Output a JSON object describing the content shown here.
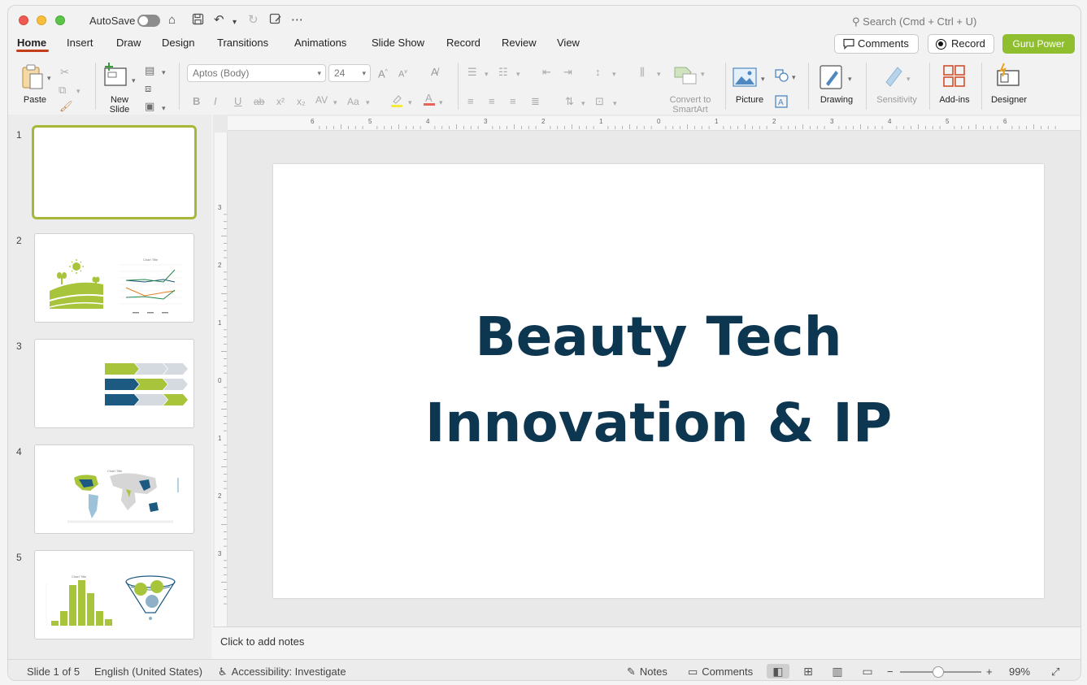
{
  "titlebar": {
    "autosave_label": "AutoSave",
    "search_placeholder": "Search (Cmd + Ctrl + U)"
  },
  "tabs": [
    {
      "label": "Home"
    },
    {
      "label": "Insert"
    },
    {
      "label": "Draw"
    },
    {
      "label": "Design"
    },
    {
      "label": "Transitions"
    },
    {
      "label": "Animations"
    },
    {
      "label": "Slide Show"
    },
    {
      "label": "Record"
    },
    {
      "label": "Review"
    },
    {
      "label": "View"
    }
  ],
  "header_buttons": {
    "comments": "Comments",
    "record": "Record",
    "guru": "Guru Power"
  },
  "ribbon": {
    "paste": "Paste",
    "new_slide_1": "New",
    "new_slide_2": "Slide",
    "font_name": "Aptos (Body)",
    "font_size": "24",
    "convert_1": "Convert to",
    "convert_2": "SmartArt",
    "picture": "Picture",
    "drawing": "Drawing",
    "sensitivity": "Sensitivity",
    "addins": "Add-ins",
    "designer": "Designer"
  },
  "thumbnails": [
    {
      "number": "1"
    },
    {
      "number": "2"
    },
    {
      "number": "3"
    },
    {
      "number": "4"
    },
    {
      "number": "5"
    }
  ],
  "slide": {
    "title_line1": "Beauty Tech",
    "title_line2": "Innovation & IP"
  },
  "ruler": {
    "h_labels": [
      "6",
      "5",
      "4",
      "3",
      "2",
      "1",
      "0",
      "1",
      "2",
      "3",
      "4",
      "5",
      "6"
    ],
    "v_labels": [
      "3",
      "2",
      "1",
      "0",
      "1",
      "2",
      "3"
    ]
  },
  "notes_placeholder": "Click to add notes",
  "status": {
    "slide_count": "Slide 1 of 5",
    "language": "English (United States)",
    "accessibility": "Accessibility: Investigate",
    "notes": "Notes",
    "comments": "Comments",
    "zoom": "99%"
  },
  "colors": {
    "accent_green": "#a7c43a",
    "title_navy": "#0d3650",
    "tab_underline": "#c43e1c"
  }
}
